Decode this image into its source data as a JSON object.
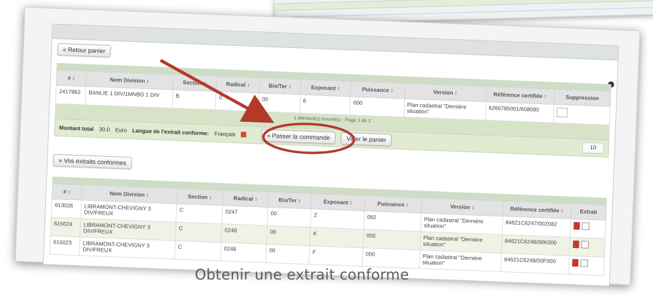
{
  "background_window": {
    "rows": 3
  },
  "panel": {
    "back_button": "« Retour panier",
    "cart_table": {
      "columns": [
        "# ↕",
        "Nom Division ↕",
        "Section ↕",
        "Radical ↕",
        "Bis/Ter ↕",
        "Exposant ↕",
        "Puissance ↕",
        "Version ↕",
        "Référence certifiée ↕",
        "Suppression"
      ],
      "rows": [
        [
          "2417862",
          "BANLIE 1 DIV/1MNBD 1 DIV",
          "B",
          "0…",
          "00",
          "8",
          "000",
          "Plan cadastral \"Dernière situation\"",
          "6266785001/608080",
          ""
        ]
      ],
      "filter_text": "1 élément(s) trouvé(s) · Page 1 de 1"
    },
    "actions": {
      "total_label": "Montant total",
      "total_value": "30.0",
      "total_unit": "Euro",
      "format_label": "Langue de l'extrait conforme:",
      "format_value": "Français",
      "order_button": "» Passer la commande",
      "empty_button": "Vider le panier",
      "pager_value": "10"
    },
    "view_button": "» Vos extraits conformes",
    "extracts_table": {
      "columns": [
        "# ↕",
        "Nom Division ↕",
        "Section ↕",
        "Radical ↕",
        "Bis/Ter ↕",
        "Exposant ↕",
        "Puissance ↕",
        "Version ↕",
        "Référence certifiée ↕",
        "Extrait"
      ],
      "rows": [
        [
          "613026",
          "LIBRAMONT-CHEVIGNY 3 DIV/FREUX",
          "C",
          "0247",
          "00",
          "Z",
          "082",
          "Plan cadastral \"Dernière situation\"",
          "84621C6247/00Z082",
          ""
        ],
        [
          "615024",
          "LIBRAMONT-CHEVIGNY 3 DIV/FREUX",
          "C",
          "0248",
          "00",
          "K",
          "000",
          "Plan cadastral \"Dernière situation\"",
          "84621C6248/00K000",
          ""
        ],
        [
          "615023",
          "LIBRAMONT-CHEVIGNY 3 DIV/FREUX",
          "C",
          "0248",
          "00",
          "F",
          "000",
          "Plan cadastral \"Dernière situation\"",
          "84621C6248/00F000",
          ""
        ]
      ]
    }
  },
  "caption": "Obtenir une extrait conforme",
  "colors": {
    "annotation_red": "#b23a2a",
    "header_green": "#cfdcc6",
    "row_green": "#eef3e6"
  },
  "icons": [
    "pdf-icon",
    "checkbox-icon",
    "close-icon",
    "red-square-icon"
  ]
}
